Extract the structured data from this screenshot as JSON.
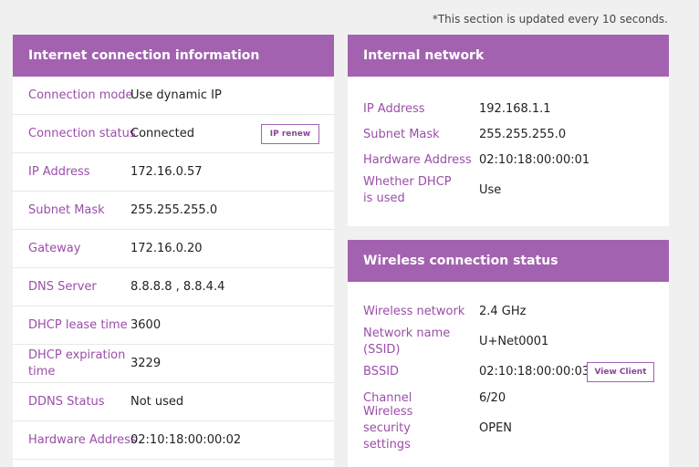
{
  "notice": "*This section is updated every 10 seconds.",
  "internet": {
    "title": "Internet connection information",
    "rows": [
      {
        "label": "Connection mode",
        "value": "Use dynamic IP"
      },
      {
        "label": "Connection status",
        "value": "Connected"
      },
      {
        "label": "IP Address",
        "value": "172.16.0.57"
      },
      {
        "label": "Subnet Mask",
        "value": "255.255.255.0"
      },
      {
        "label": "Gateway",
        "value": "172.16.0.20"
      },
      {
        "label": "DNS Server",
        "value": "8.8.8.8 , 8.8.4.4"
      },
      {
        "label": "DHCP lease time",
        "value": "3600"
      },
      {
        "label": "DHCP expiration time",
        "value": "3229"
      },
      {
        "label": "DDNS Status",
        "value": "Not used"
      },
      {
        "label": "Hardware Address",
        "value": "02:10:18:00:00:02"
      }
    ],
    "ip_renew_label": "IP renew"
  },
  "internal": {
    "title": "Internal network",
    "rows": [
      {
        "label": "IP Address",
        "value": "192.168.1.1"
      },
      {
        "label": "Subnet Mask",
        "value": "255.255.255.0"
      },
      {
        "label": "Hardware Address",
        "value": "02:10:18:00:00:01"
      },
      {
        "label": "Whether DHCP is used",
        "value": "Use"
      }
    ]
  },
  "wireless": {
    "title": "Wireless connection status",
    "rows": [
      {
        "label": "Wireless network",
        "value": "2.4 GHz"
      },
      {
        "label": "Network name (SSID)",
        "value": "U+Net0001"
      },
      {
        "label": "BSSID",
        "value": "02:10:18:00:00:03"
      },
      {
        "label": "Channel",
        "value": "6/20"
      },
      {
        "label": "Wireless security settings",
        "value": "OPEN"
      }
    ],
    "view_client_label": "View Client"
  },
  "colors": {
    "accent": "#a362b0",
    "label": "#9b4ea9"
  }
}
